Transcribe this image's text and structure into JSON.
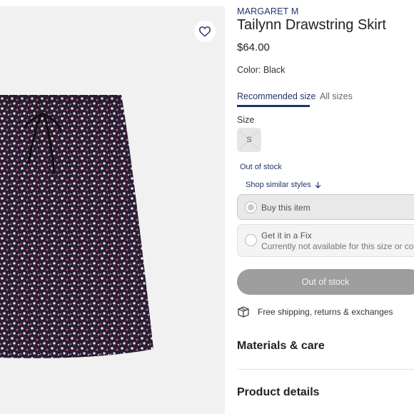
{
  "product": {
    "brand": "MARGARET M",
    "title": "Tailynn Drawstring Skirt",
    "price": "$64.00",
    "color_label": "Color:",
    "color_value": "Black"
  },
  "icons": {
    "favorite": "heart-outline-icon",
    "similar_arrow": "arrow-down-icon",
    "shipping": "box-package-icon"
  },
  "size_tabs": [
    {
      "label": "Recommended size",
      "active": true
    },
    {
      "label": "All sizes",
      "active": false
    }
  ],
  "size": {
    "label": "Size",
    "options": [
      "S"
    ],
    "availability": "Out of stock"
  },
  "shop_similar": "Shop similar styles",
  "purchase_options": {
    "buy": {
      "label": "Buy this item"
    },
    "fix": {
      "label": "Get it in a Fix",
      "sublabel": "Currently not available for this size or color"
    }
  },
  "cta": {
    "label": "Out of stock"
  },
  "shipping_text": "Free shipping, returns & exchanges",
  "sections": {
    "materials": "Materials & care",
    "details": "Product details"
  },
  "colors": {
    "brand_navy": "#23336b",
    "disabled_button": "#9e9e9e",
    "image_bg": "#f1f1f2"
  }
}
